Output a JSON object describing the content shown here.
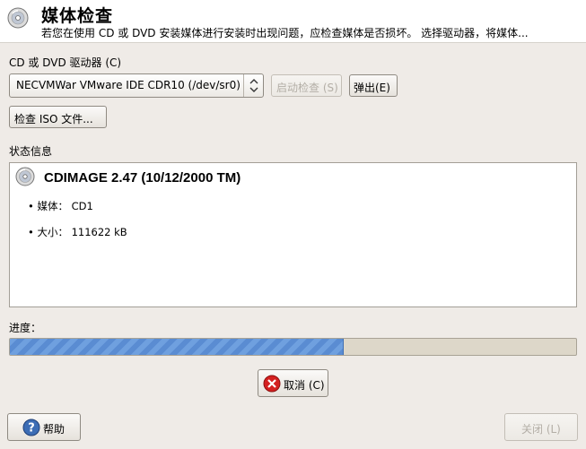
{
  "header": {
    "title": "媒体检查",
    "subtitle": "若您在使用 CD 或 DVD 安装媒体进行安装时出现问题，应检查媒体是否损坏。 选择驱动器，将媒体..."
  },
  "drive": {
    "label": "CD 或 DVD 驱动器 (C)",
    "selected": "NECVMWar VMware IDE CDR10 (/dev/sr0)",
    "start_check": "启动检查 (S)",
    "eject": "弹出(E)",
    "check_iso": "检查 ISO 文件..."
  },
  "status": {
    "label": "状态信息",
    "title": "CDIMAGE 2.47 (10/12/2000 TM)",
    "media": "• 媒体： CD1",
    "size": "• 大小： 111622  kB"
  },
  "progress": {
    "label": "进度：",
    "fraction": 0.59
  },
  "buttons": {
    "cancel": "取消 (C)",
    "help": "帮助",
    "close": "关闭 (L)"
  },
  "colors": {
    "accent": "#6fa0df",
    "cancel_icon": "#d42020",
    "help_icon": "#3c6db5"
  }
}
